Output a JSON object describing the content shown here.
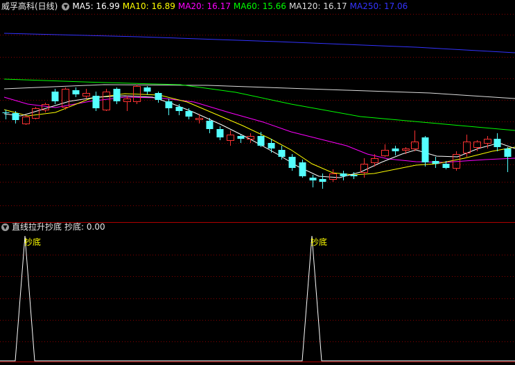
{
  "main_panel": {
    "title": "威孚高科(日线)",
    "toggle_icon": "chevron-down-icon",
    "indicators": [
      {
        "label": "MA5: 16.99",
        "color": "#ffffff"
      },
      {
        "label": "MA10: 16.89",
        "color": "#ffff00"
      },
      {
        "label": "MA20: 16.17",
        "color": "#ff00ff"
      },
      {
        "label": "MA60: 15.66",
        "color": "#00ff00"
      },
      {
        "label": "MA120: 16.17",
        "color": "#dddddd"
      },
      {
        "label": "MA250: 17.06",
        "color": "#3333ff"
      }
    ]
  },
  "sub_panel": {
    "title": "直线拉升抄底",
    "value_label": "抄底: 0.00",
    "toggle_icon": "chevron-down-icon",
    "signals": [
      {
        "label": "抄底"
      },
      {
        "label": "抄底"
      }
    ]
  },
  "colors": {
    "up": "#ff3232",
    "down": "#54ffff",
    "grid": "#8b0000",
    "separator": "#b00000"
  }
}
